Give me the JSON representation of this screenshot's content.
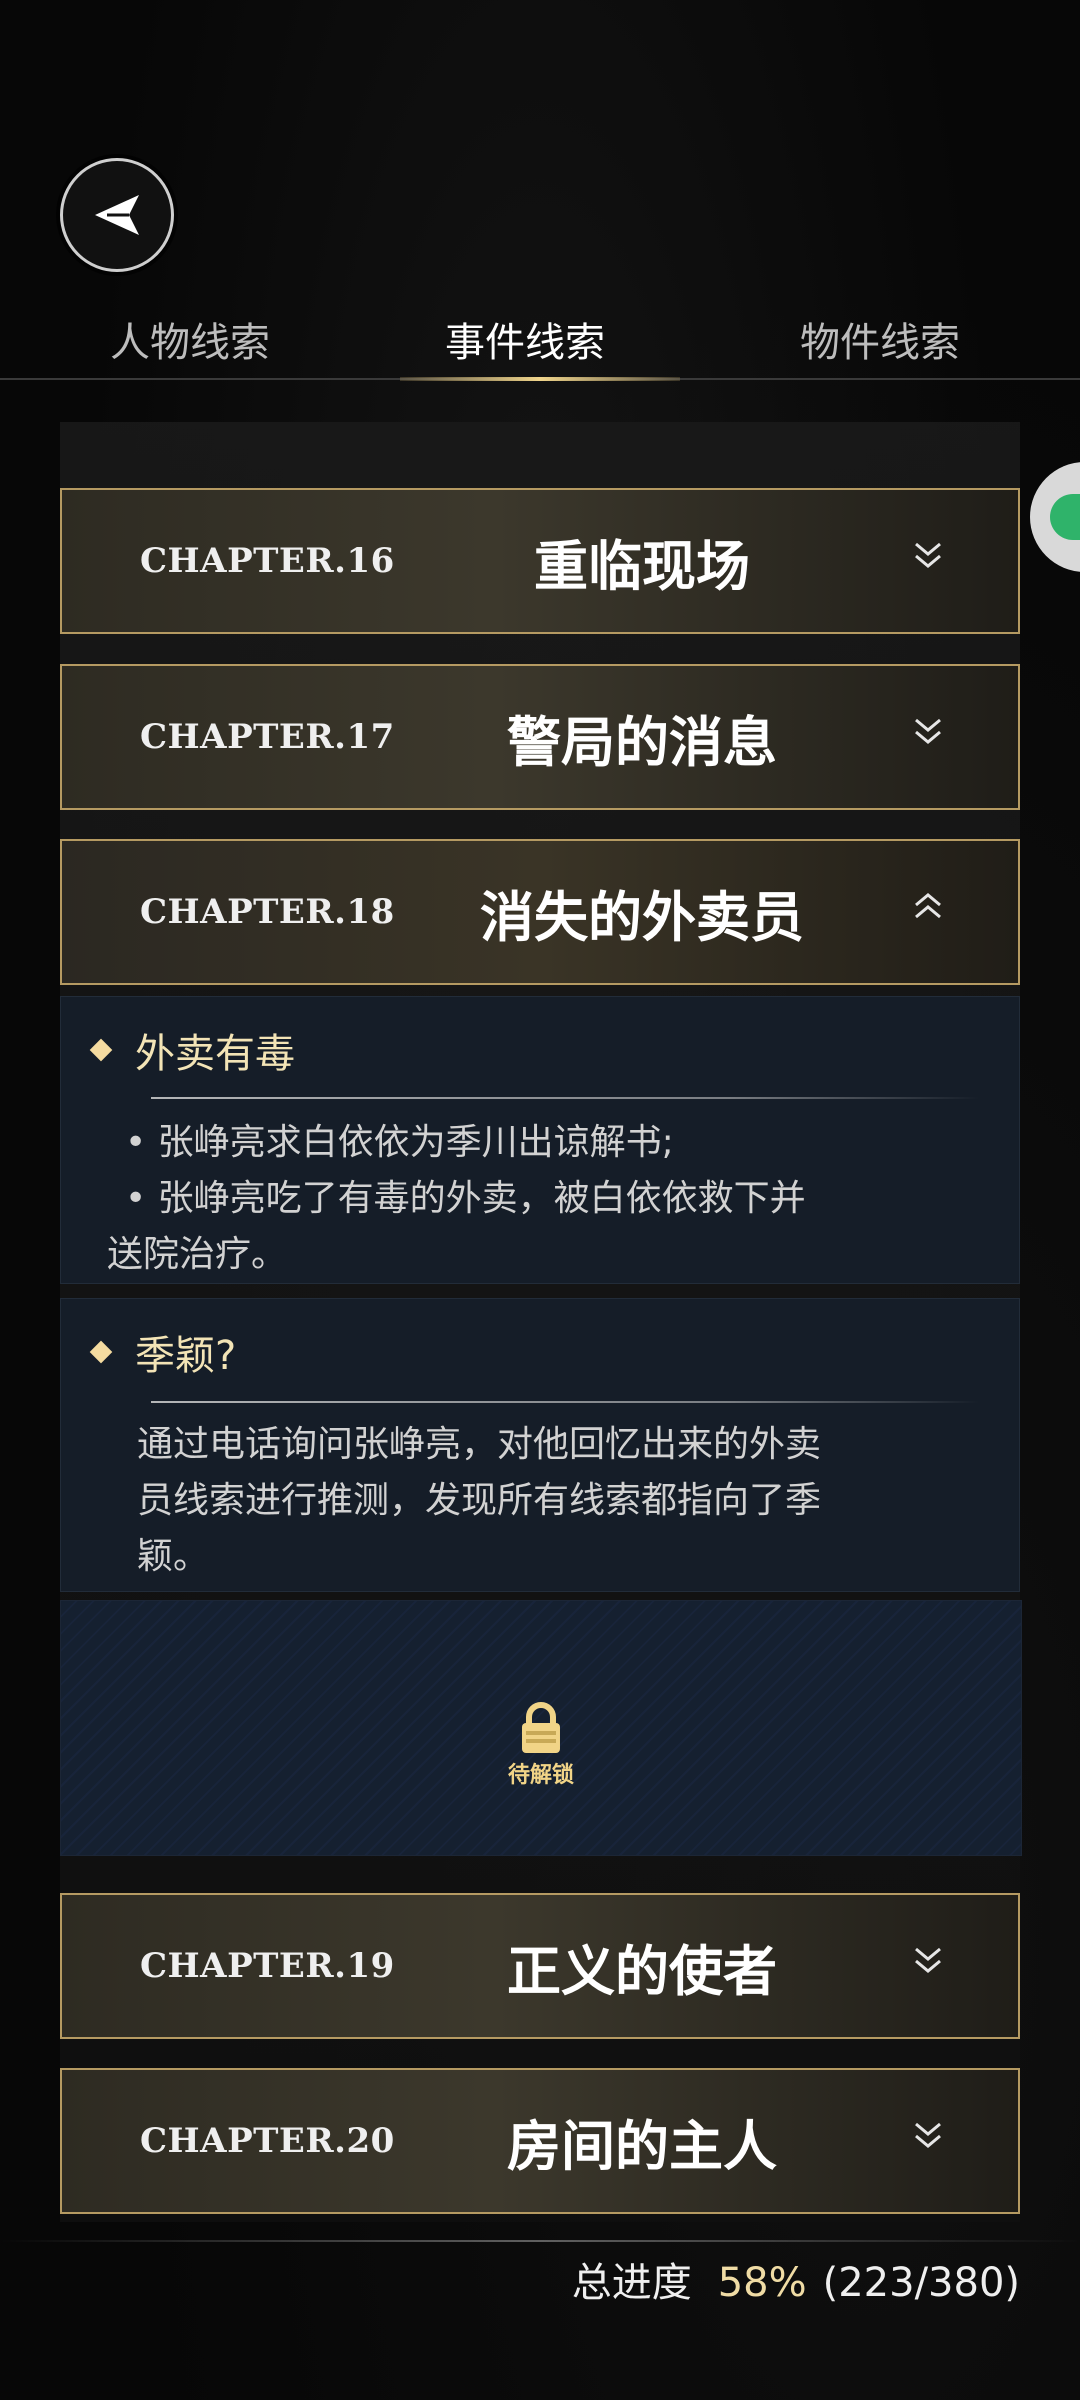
{
  "header": {
    "back_icon": "back-arrow-icon"
  },
  "tabs": [
    {
      "label": "人物线索",
      "active": false
    },
    {
      "label": "事件线索",
      "active": true
    },
    {
      "label": "物件线索",
      "active": false
    }
  ],
  "chapters": [
    {
      "number": "CHAPTER.16",
      "title": "重临现场",
      "expanded": false
    },
    {
      "number": "CHAPTER.17",
      "title": "警局的消息",
      "expanded": false
    },
    {
      "number": "CHAPTER.18",
      "title": "消失的外卖员",
      "expanded": true
    },
    {
      "number": "CHAPTER.19",
      "title": "正义的使者",
      "expanded": false
    },
    {
      "number": "CHAPTER.20",
      "title": "房间的主人",
      "expanded": false
    }
  ],
  "clues": [
    {
      "title": "外卖有毒",
      "lines": [
        "• 张峥亮求白依依为季川出谅解书;",
        "• 张峥亮吃了有毒的外卖，被白依依救下并",
        "送院治疗。"
      ]
    },
    {
      "title": "季颖?",
      "lines": [
        "通过电话询问张峥亮，对他回忆出来的外卖",
        "员线索进行推测，发现所有线索都指向了季",
        "颖。"
      ]
    }
  ],
  "locked": {
    "label": "待解锁",
    "icon": "lock-icon"
  },
  "progress": {
    "label": "总进度",
    "percent": "58%",
    "count": "(223/380)"
  },
  "colors": {
    "gold": "#f0d58c",
    "border_gold": "#b59a62",
    "card_blue": "#151d28"
  }
}
